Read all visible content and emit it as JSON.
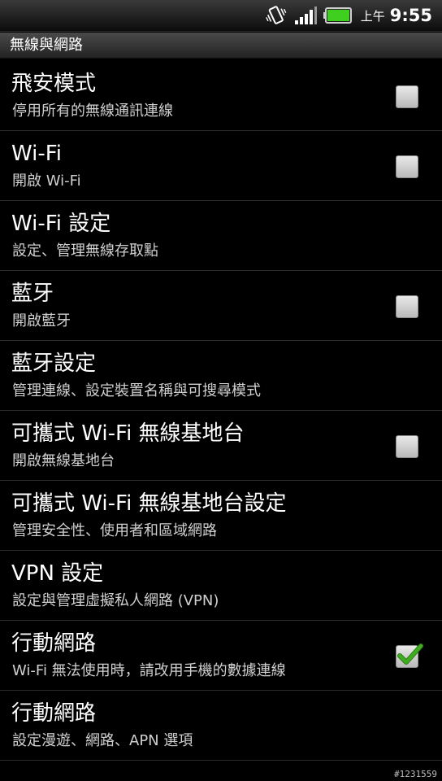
{
  "status_bar": {
    "ampm": "上午",
    "time": "9:55",
    "icons": [
      "vibrate-icon",
      "signal-icon",
      "battery-icon"
    ],
    "battery_color": "#3fcf1f"
  },
  "section_header": "無線與網路",
  "items": [
    {
      "title": "飛安模式",
      "summary": "停用所有的無線通訊連線",
      "has_checkbox": true,
      "checked": false
    },
    {
      "title": "Wi-Fi",
      "summary": "開啟 Wi-Fi",
      "has_checkbox": true,
      "checked": false
    },
    {
      "title": "Wi-Fi 設定",
      "summary": "設定、管理無線存取點",
      "has_checkbox": false,
      "checked": false
    },
    {
      "title": "藍牙",
      "summary": "開啟藍牙",
      "has_checkbox": true,
      "checked": false
    },
    {
      "title": "藍牙設定",
      "summary": "管理連線、設定裝置名稱與可搜尋模式",
      "has_checkbox": false,
      "checked": false
    },
    {
      "title": "可攜式 Wi-Fi 無線基地台",
      "summary": "開啟無線基地台",
      "has_checkbox": true,
      "checked": false
    },
    {
      "title": "可攜式 Wi-Fi 無線基地台設定",
      "summary": "管理安全性、使用者和區域網路",
      "has_checkbox": false,
      "checked": false
    },
    {
      "title": "VPN 設定",
      "summary": "設定與管理虛擬私人網路 (VPN)",
      "has_checkbox": false,
      "checked": false
    },
    {
      "title": "行動網路",
      "summary": "Wi-Fi 無法使用時，請改用手機的數據連線",
      "has_checkbox": true,
      "checked": true
    },
    {
      "title": "行動網路",
      "summary": "設定漫遊、網路、APN 選項",
      "has_checkbox": false,
      "checked": false
    }
  ],
  "check_color": "#3fae1e",
  "footer_tag": "#1231559"
}
